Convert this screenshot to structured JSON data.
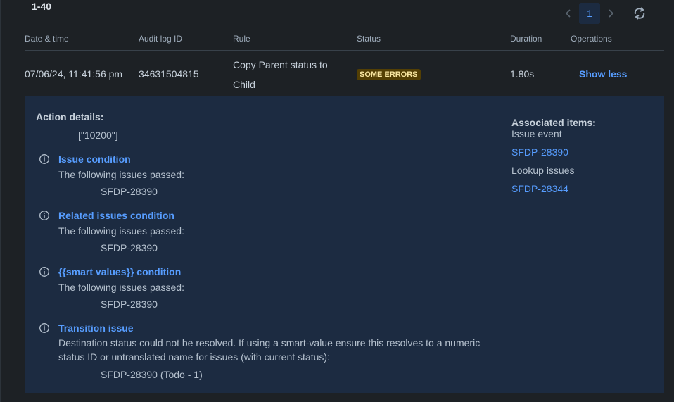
{
  "pagination": {
    "range": "1-40",
    "prev_icon": "chevron-left-icon",
    "current_page": "1",
    "next_icon": "chevron-right-icon",
    "refresh_icon": "refresh-icon"
  },
  "table": {
    "columns": [
      "Date & time",
      "Audit log ID",
      "Rule",
      "Status",
      "Duration",
      "Operations"
    ],
    "row": {
      "datetime": "07/06/24, 11:41:56 pm",
      "audit_id": "34631504815",
      "rule": "Copy Parent status to Child",
      "status": "SOME ERRORS",
      "duration": "1.80s",
      "operation": "Show less"
    }
  },
  "details": {
    "action_title": "Action details:",
    "action_value": "[\"10200\"]",
    "conditions": [
      {
        "title": "Issue condition",
        "text": "The following issues passed:",
        "value": "SFDP-28390"
      },
      {
        "title": "Related issues condition",
        "text": "The following issues passed:",
        "value": "SFDP-28390"
      },
      {
        "title": "{{smart values}} condition",
        "text": "The following issues passed:",
        "value": "SFDP-28390"
      }
    ],
    "transition": {
      "title": "Transition issue",
      "text": "Destination status could not be resolved. If using a smart-value ensure this resolves to a numeric status ID or untranslated name for issues (with current status):",
      "value": "SFDP-28390 (Todo - 1)"
    },
    "associated": {
      "title": "Associated items:",
      "event_label": "Issue event",
      "event_link": "SFDP-28390",
      "lookup_label": "Lookup issues",
      "lookup_link": "SFDP-28344"
    }
  },
  "colors": {
    "background": "#1d2125",
    "panel": "#1c2b41",
    "link": "#579dff",
    "badge_bg": "#533f04",
    "badge_text": "#f8e6a0"
  }
}
